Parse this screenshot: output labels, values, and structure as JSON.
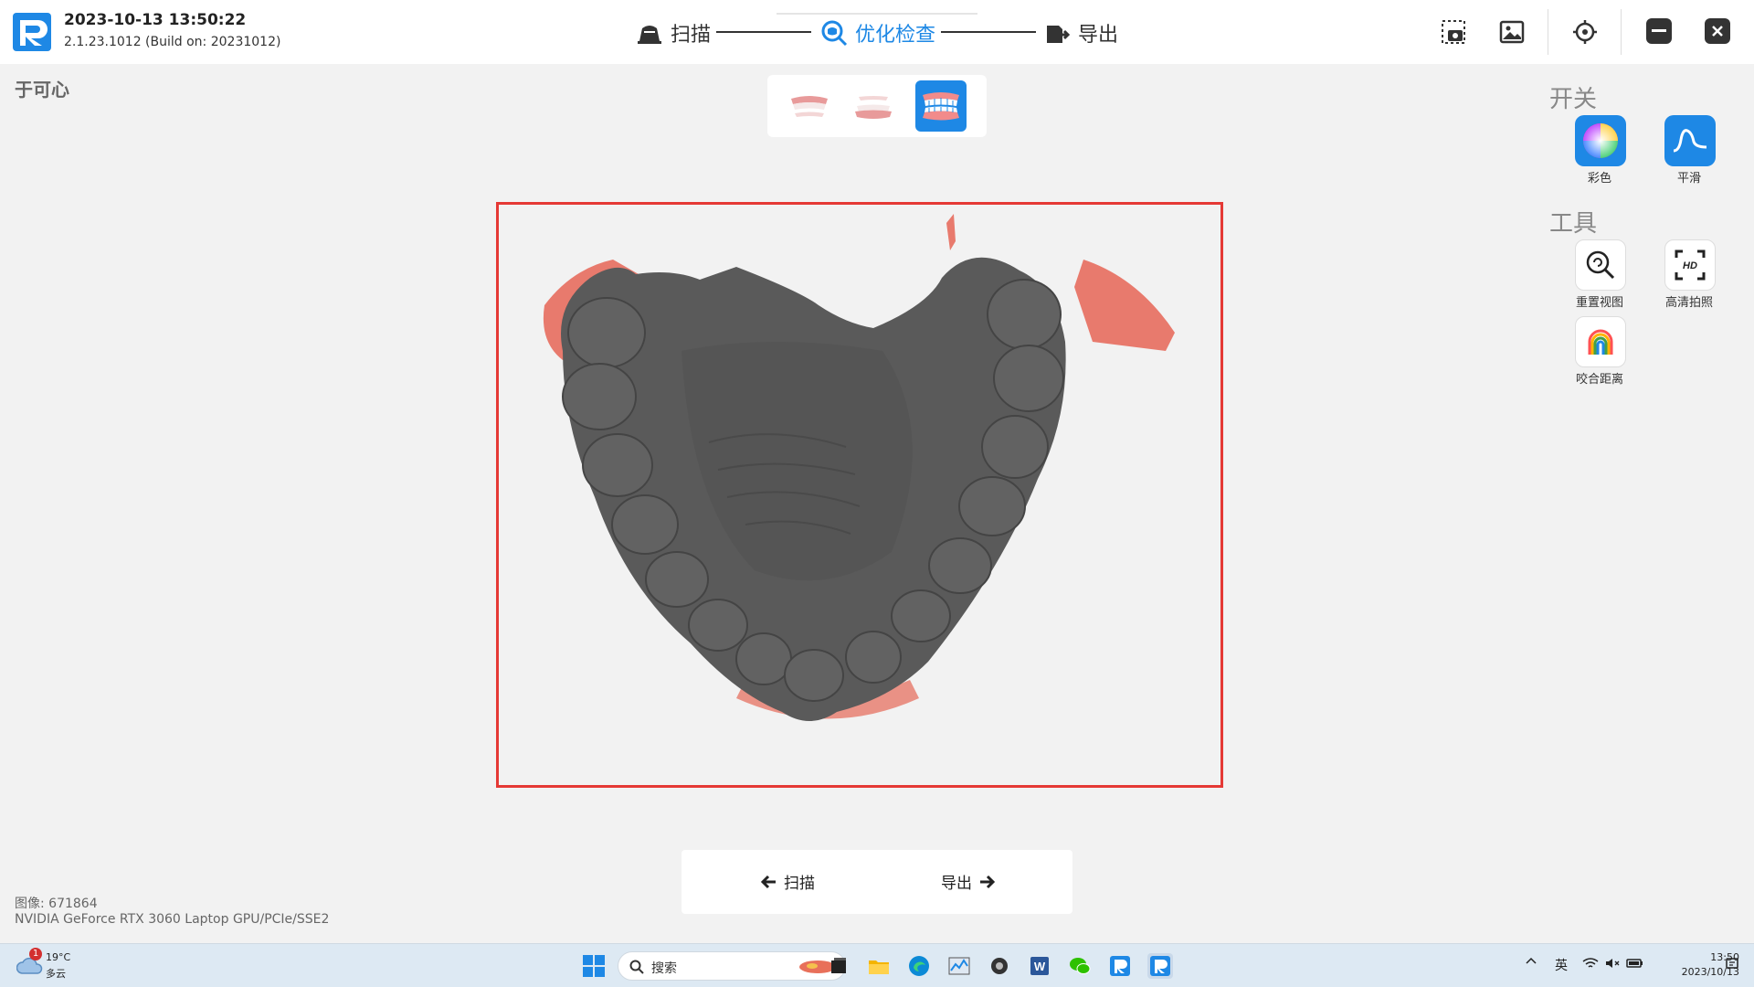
{
  "app": {
    "datetime": "2023-10-13 13:50:22",
    "version": "2.1.23.1012 (Build on: 20231012)",
    "patient": "于可心",
    "brand_color": "#1e88e5"
  },
  "steps": [
    {
      "label": "扫描",
      "icon": "scan-icon",
      "active": false
    },
    {
      "label": "优化检查",
      "icon": "optimize-check-icon",
      "active": true
    },
    {
      "label": "导出",
      "icon": "export-icon",
      "active": false
    }
  ],
  "toolbar_icons": [
    "screenshot-icon",
    "image-gallery-icon",
    "locate-icon",
    "minimize-icon",
    "close-icon"
  ],
  "view_options": [
    "upper-jaw-view",
    "lower-jaw-view",
    "occlusion-view"
  ],
  "right_panel": {
    "switch_title": "开关",
    "tools_title": "工具",
    "switches": [
      {
        "label": "彩色",
        "icon": "color-icon"
      },
      {
        "label": "平滑",
        "icon": "smooth-icon"
      }
    ],
    "tools": [
      {
        "label": "重置视图",
        "icon": "reset-view-icon"
      },
      {
        "label": "高清拍照",
        "icon": "hd-photo-icon"
      },
      {
        "label": "咬合距离",
        "icon": "bite-distance-icon"
      }
    ]
  },
  "bottom_nav": {
    "prev_label": "扫描",
    "next_label": "导出"
  },
  "info": {
    "image_count": "图像: 671864",
    "gpu": "NVIDIA GeForce RTX 3060 Laptop GPU/PCIe/SSE2"
  },
  "taskbar": {
    "weather_temp": "19°C",
    "weather_desc": "多云",
    "weather_badge": "1",
    "search_placeholder": "搜索",
    "ime": "英",
    "time": "13:50",
    "date": "2023/10/13"
  }
}
